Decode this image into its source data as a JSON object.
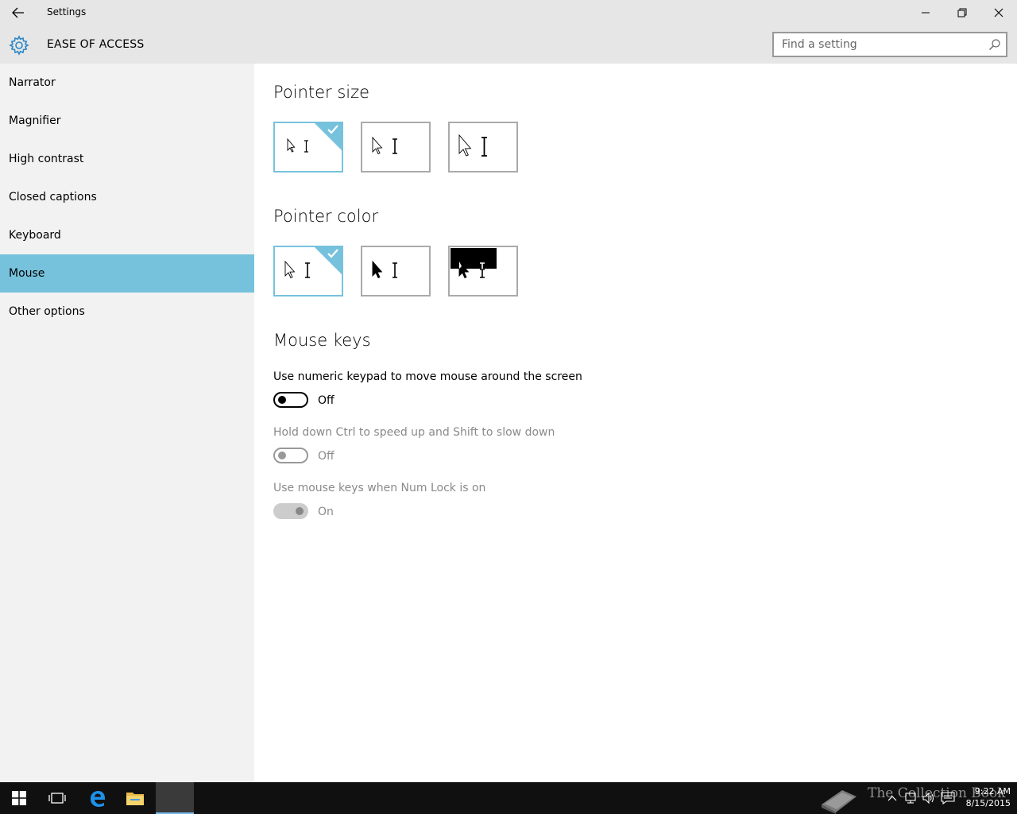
{
  "window": {
    "title": "Settings"
  },
  "header": {
    "section_title": "EASE OF ACCESS",
    "search_placeholder": "Find a setting"
  },
  "sidebar": {
    "items": [
      {
        "label": "Narrator"
      },
      {
        "label": "Magnifier"
      },
      {
        "label": "High contrast"
      },
      {
        "label": "Closed captions"
      },
      {
        "label": "Keyboard"
      },
      {
        "label": "Mouse",
        "selected": true
      },
      {
        "label": "Other options"
      }
    ]
  },
  "main": {
    "pointer_size": {
      "title": "Pointer size",
      "options": [
        "small",
        "medium",
        "large"
      ],
      "selected": "small"
    },
    "pointer_color": {
      "title": "Pointer color",
      "options": [
        "white",
        "black",
        "inverted"
      ],
      "selected": "white"
    },
    "mouse_keys": {
      "title": "Mouse keys",
      "settings": [
        {
          "label": "Use numeric keypad to move mouse around the screen",
          "state": "Off",
          "enabled": true
        },
        {
          "label": "Hold down Ctrl to speed up and Shift to slow down",
          "state": "Off",
          "enabled": false
        },
        {
          "label": "Use mouse keys when Num Lock is on",
          "state": "On",
          "enabled": false
        }
      ]
    }
  },
  "taskbar": {
    "time": "9:22 AM",
    "date": "8/15/2015",
    "watermark": "The Collection Book"
  },
  "colors": {
    "accent": "#76c2dd",
    "chrome": "#e6e6e6",
    "sidebar": "#f2f2f2",
    "taskbar": "#101010"
  }
}
